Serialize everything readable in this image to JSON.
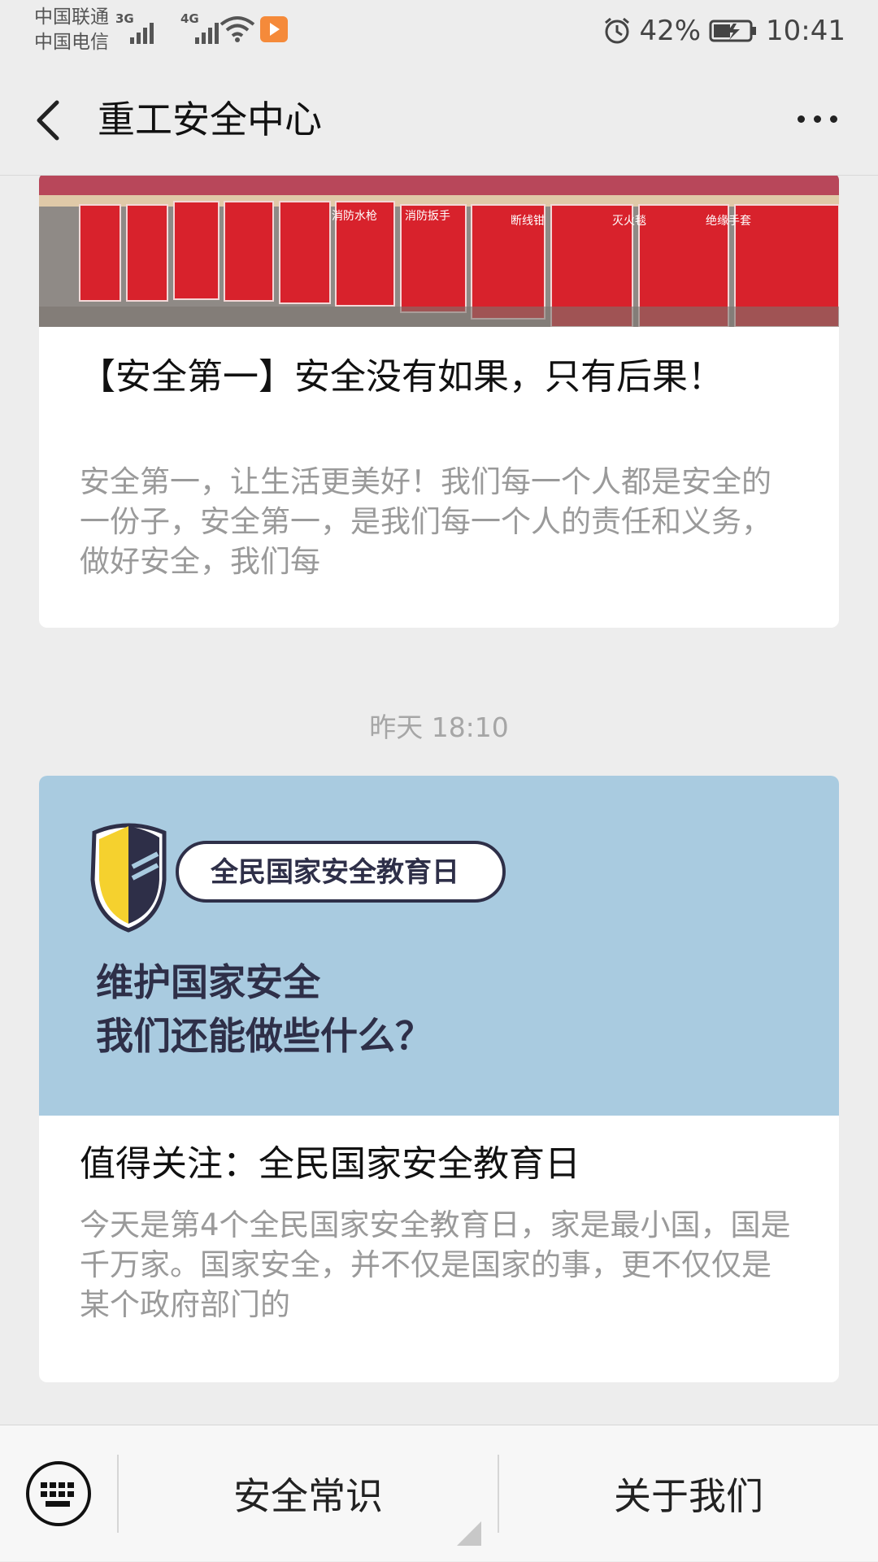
{
  "status_bar": {
    "carrier_1": "中国联通",
    "carrier_2": "中国电信",
    "network_1": "3G",
    "network_2": "4G",
    "battery": "42%",
    "time": "10:41"
  },
  "header": {
    "title": "重工安全中心"
  },
  "articles": [
    {
      "title": "【安全第一】安全没有如果，只有后果！",
      "summary": "安全第一，让生活更美好！我们每一个人都是安全的一份子，安全第一，是我们每一个人的责任和义务，做好安全，我们每",
      "image_labels": [
        "绝缘手套",
        "灭火毯",
        "断线钳",
        "消防扳手",
        "消防水枪"
      ]
    },
    {
      "title": "值得关注：全民国家安全教育日",
      "summary": "今天是第4个全民国家安全教育日，家是最小国，国是千万家。国家安全，并不仅是国家的事，更不仅仅是某个政府部门的",
      "image_badge": "全民国家安全教育日",
      "image_headline_1": "维护国家安全",
      "image_headline_2": "我们还能做些什么？"
    }
  ],
  "timestamp": "昨天 18:10",
  "bottom_menu": {
    "items": [
      "安全常识",
      "关于我们"
    ]
  },
  "colors": {
    "background": "#ededed",
    "card": "#ffffff",
    "summary_text": "#9a9a9a",
    "poster_blue": "#a9cbe0",
    "panel_red": "#d8222c"
  }
}
